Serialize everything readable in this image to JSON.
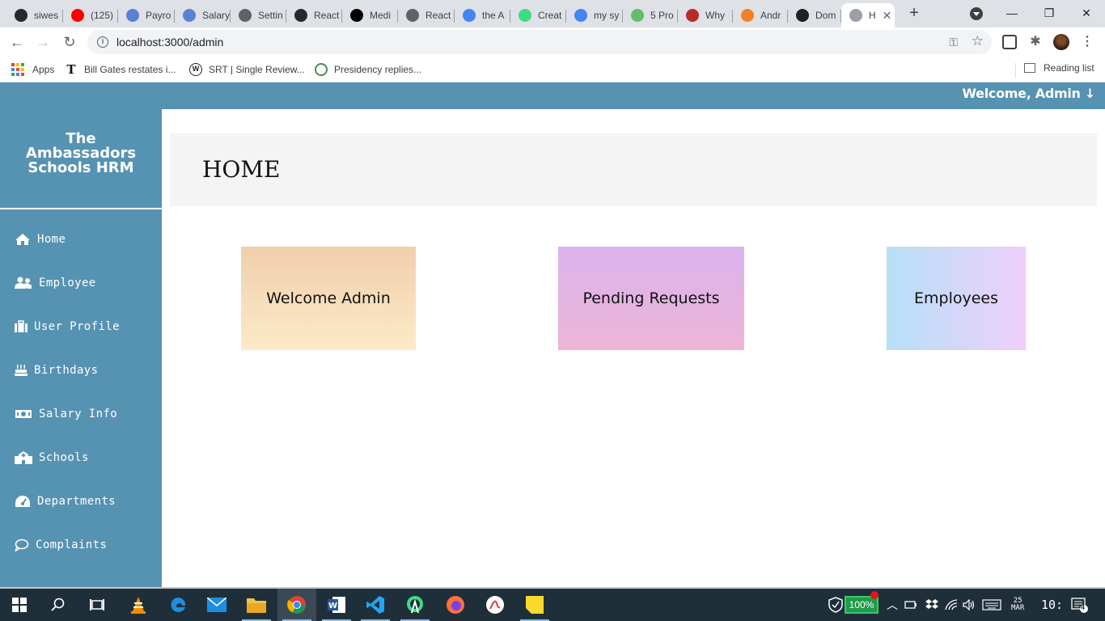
{
  "browser": {
    "tabs": [
      {
        "label": "siwes",
        "icon": "github-icon",
        "color": "#24292e"
      },
      {
        "label": "(125)",
        "icon": "youtube-icon",
        "color": "#ff0000"
      },
      {
        "label": "Payro",
        "icon": "globe-icon",
        "color": "#5b7fd6"
      },
      {
        "label": "Salary",
        "icon": "globe-icon",
        "color": "#5b7fd6"
      },
      {
        "label": "Settin",
        "icon": "globe-icon",
        "color": "#5f6368"
      },
      {
        "label": "React",
        "icon": "github-icon",
        "color": "#24292e"
      },
      {
        "label": "Medi",
        "icon": "medium-icon",
        "color": "#000000"
      },
      {
        "label": "React",
        "icon": "diamond-icon",
        "color": "#5f6368"
      },
      {
        "label": "the A",
        "icon": "google-icon",
        "color": "#4285f4"
      },
      {
        "label": "Creat",
        "icon": "android-icon",
        "color": "#3ddc84"
      },
      {
        "label": "my sy",
        "icon": "google-icon",
        "color": "#4285f4"
      },
      {
        "label": "5 Pro",
        "icon": "bolt-icon",
        "color": "#66bb6a"
      },
      {
        "label": "Why",
        "icon": "quora-icon",
        "color": "#b92b27"
      },
      {
        "label": "Andr",
        "icon": "stackoverflow-icon",
        "color": "#f48024"
      },
      {
        "label": "Dom",
        "icon": "dom-icon",
        "color": "#202124"
      },
      {
        "label": "H",
        "icon": "page-icon",
        "color": "#9aa0a6",
        "active": true
      }
    ],
    "new_tab": "+",
    "window_controls": {
      "minimize": "—",
      "restore": "❐",
      "close": "✕"
    },
    "url": "localhost:3000/admin",
    "bookmarks": [
      {
        "label": "Apps",
        "icon": "apps-grid-icon"
      },
      {
        "label": "Bill Gates restates i...",
        "icon": "tribune-icon"
      },
      {
        "label": "SRT | Single Review...",
        "icon": "wordpress-icon"
      },
      {
        "label": "Presidency replies...",
        "icon": "news-icon"
      }
    ],
    "reading_list": "Reading list"
  },
  "app": {
    "welcome": "Welcome, Admin ↓",
    "brand": [
      "The",
      "Ambassadors",
      "Schools HRM"
    ],
    "nav": [
      {
        "label": "Home",
        "icon": "home-icon"
      },
      {
        "label": "Employee",
        "icon": "users-icon"
      },
      {
        "label": "User Profile",
        "icon": "briefcase-icon"
      },
      {
        "label": "Birthdays",
        "icon": "birthday-cake-icon"
      },
      {
        "label": "Salary Info",
        "icon": "money-bill-icon"
      },
      {
        "label": "Schools",
        "icon": "school-icon"
      },
      {
        "label": "Departments",
        "icon": "tachometer-icon"
      },
      {
        "label": "Complaints",
        "icon": "comment-icon"
      }
    ],
    "page_title": "HOME",
    "cards": [
      {
        "label": "Welcome Admin"
      },
      {
        "label": "Pending Requests"
      },
      {
        "label": "Employees"
      }
    ]
  },
  "taskbar": {
    "battery": "100%",
    "date_top": "25",
    "date_bottom": "MAR",
    "time": "10:",
    "notifications": "4"
  },
  "colors": {
    "sidebar": "#5692b2",
    "header_bg": "#f4f4f4"
  }
}
